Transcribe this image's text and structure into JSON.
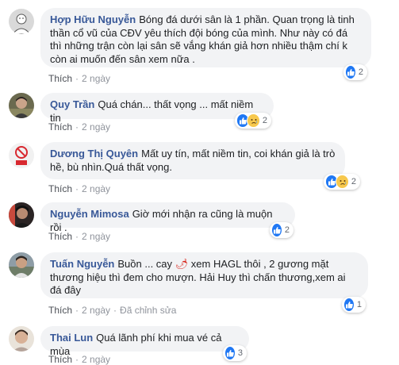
{
  "colors": {
    "author": "#385898",
    "bubble_bg": "#f2f3f5",
    "meta": "#90949c",
    "like_blue": "#2078f4",
    "sad_yellow": "#f7c84c"
  },
  "comments": [
    {
      "author": "Hợp Hữu Nguyễn",
      "text": "Bóng đá dưới sân là 1 phần. Quan trọng là tinh thần cổ vũ của CĐV yêu thích đội bóng của mình. Như này có đá thì những trận còn lại sân sẽ vắng khán giả hơn nhiều thậm chí k còn ai muốn đến sân xem nữa .",
      "like_label": "Thích",
      "time": "2 ngày",
      "reaction_icons": [
        "like-icon"
      ],
      "reaction_count": "2"
    },
    {
      "author": "Quy Trần",
      "text": "Quá chán... thất vọng ... mất niềm tin",
      "like_label": "Thích",
      "time": "2 ngày",
      "reaction_icons": [
        "like-icon",
        "sad-icon"
      ],
      "reaction_count": "2"
    },
    {
      "author": "Dương Thị Quyên",
      "text": "Mất uy tín, mất niềm tin, coi khán giả là trò hề, bù nhìn.Quá thất vọng.",
      "like_label": "Thích",
      "time": "2 ngày",
      "reaction_icons": [
        "like-icon",
        "sad-icon"
      ],
      "reaction_count": "2"
    },
    {
      "author": "Nguyễn Mimosa",
      "text": "Giờ mới nhận ra cũng là muộn rồi .",
      "like_label": "Thích",
      "time": "2 ngày",
      "reaction_icons": [
        "like-icon"
      ],
      "reaction_count": "2"
    },
    {
      "author": "Tuấn Nguyễn",
      "text_before": "Buồn ... cay",
      "emoji": "🌶",
      "text_after": "xem HAGL thôi , 2 gương mặt thương hiệu thì đem cho mượn. Hải Huy thì chấn thương,xem ai đá đây",
      "like_label": "Thích",
      "time": "2 ngày",
      "edited": "Đã chỉnh sửa",
      "reaction_icons": [
        "like-icon"
      ],
      "reaction_count": "1"
    },
    {
      "author": "Thai Lun",
      "text": "Quá lãnh phí khi mua vé cả mùa",
      "like_label": "Thích",
      "time": "2 ngày",
      "reaction_icons": [
        "like-icon"
      ],
      "reaction_count": "3"
    }
  ]
}
